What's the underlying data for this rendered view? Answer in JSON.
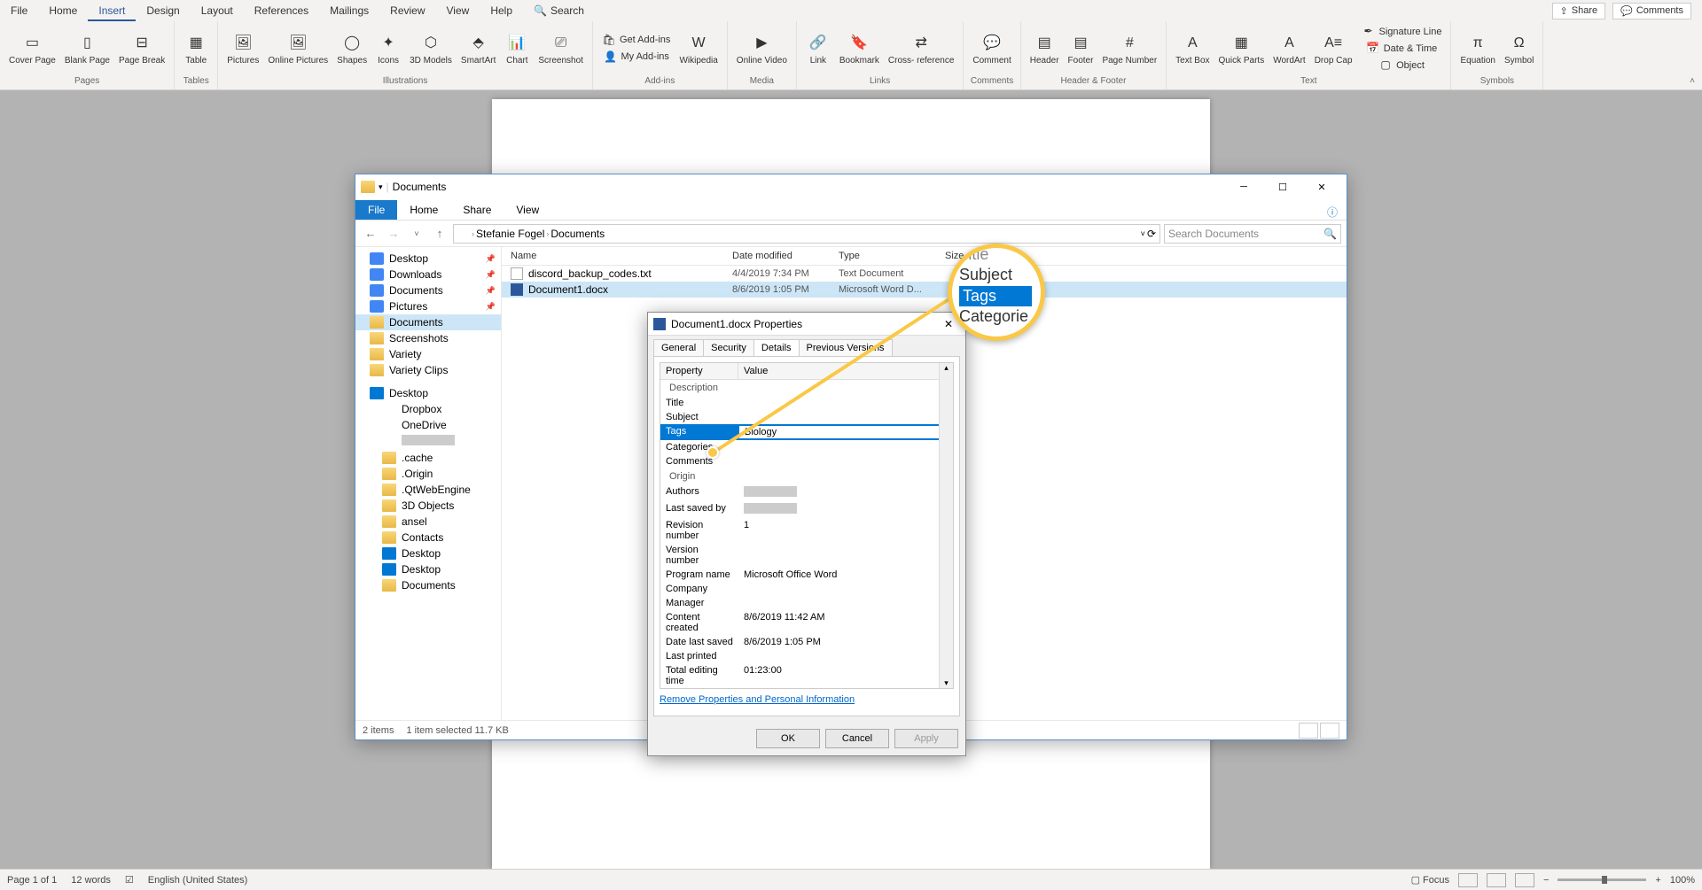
{
  "ribbon": {
    "tabs": [
      "File",
      "Home",
      "Insert",
      "Design",
      "Layout",
      "References",
      "Mailings",
      "Review",
      "View",
      "Help"
    ],
    "active_tab": "Insert",
    "search_label": "Search",
    "share_label": "Share",
    "comments_label": "Comments",
    "groups": {
      "pages": {
        "label": "Pages",
        "items": [
          "Cover\nPage",
          "Blank\nPage",
          "Page\nBreak"
        ]
      },
      "tables": {
        "label": "Tables",
        "items": [
          "Table"
        ]
      },
      "illustrations": {
        "label": "Illustrations",
        "items": [
          "Pictures",
          "Online\nPictures",
          "Shapes",
          "Icons",
          "3D\nModels",
          "SmartArt",
          "Chart",
          "Screenshot"
        ]
      },
      "addins": {
        "label": "Add-ins",
        "get": "Get Add-ins",
        "my": "My Add-ins",
        "wiki": "Wikipedia"
      },
      "media": {
        "label": "Media",
        "items": [
          "Online\nVideo"
        ]
      },
      "links": {
        "label": "Links",
        "items": [
          "Link",
          "Bookmark",
          "Cross-\nreference"
        ]
      },
      "comments": {
        "label": "Comments",
        "items": [
          "Comment"
        ]
      },
      "header_footer": {
        "label": "Header & Footer",
        "items": [
          "Header",
          "Footer",
          "Page\nNumber"
        ]
      },
      "text": {
        "label": "Text",
        "items": [
          "Text\nBox",
          "Quick\nParts",
          "WordArt",
          "Drop\nCap"
        ],
        "side": [
          "Signature Line",
          "Date & Time",
          "Object"
        ]
      },
      "symbols": {
        "label": "Symbols",
        "items": [
          "Equation",
          "Symbol"
        ]
      }
    }
  },
  "explorer": {
    "title": "Documents",
    "tabs": {
      "file": "File",
      "home": "Home",
      "share": "Share",
      "view": "View"
    },
    "breadcrumb": [
      "Stefanie Fogel",
      "Documents"
    ],
    "search_placeholder": "Search Documents",
    "columns": {
      "name": "Name",
      "date": "Date modified",
      "type": "Type",
      "size": "Size"
    },
    "files": [
      {
        "name": "discord_backup_codes.txt",
        "date": "4/4/2019 7:34 PM",
        "type": "Text Document",
        "selected": false,
        "kind": "txt"
      },
      {
        "name": "Document1.docx",
        "date": "8/6/2019 1:05 PM",
        "type": "Microsoft Word D...",
        "selected": true,
        "kind": "word"
      }
    ],
    "nav_quick": [
      {
        "label": "Desktop",
        "ico": "blue",
        "pin": true
      },
      {
        "label": "Downloads",
        "ico": "blue",
        "pin": true
      },
      {
        "label": "Documents",
        "ico": "blue",
        "pin": true
      },
      {
        "label": "Pictures",
        "ico": "blue",
        "pin": true
      },
      {
        "label": "Documents",
        "ico": "folder",
        "selected": true
      },
      {
        "label": "Screenshots",
        "ico": "folder"
      },
      {
        "label": "Variety",
        "ico": "folder"
      },
      {
        "label": "Variety Clips",
        "ico": "folder"
      }
    ],
    "nav_desktop": [
      {
        "label": "Desktop",
        "ico": "monitor"
      },
      {
        "label": "Dropbox",
        "ico": "cloud",
        "indent": true
      },
      {
        "label": "OneDrive",
        "ico": "cloud",
        "indent": true
      },
      {
        "label": "",
        "ico": "green",
        "indent": true
      },
      {
        "label": ".cache",
        "ico": "folder",
        "indent": true
      },
      {
        "label": ".Origin",
        "ico": "folder",
        "indent": true
      },
      {
        "label": ".QtWebEngine",
        "ico": "folder",
        "indent": true
      },
      {
        "label": "3D Objects",
        "ico": "folder",
        "indent": true
      },
      {
        "label": "ansel",
        "ico": "folder",
        "indent": true
      },
      {
        "label": "Contacts",
        "ico": "folder",
        "indent": true
      },
      {
        "label": "Desktop",
        "ico": "monitor",
        "indent": true
      },
      {
        "label": "Desktop",
        "ico": "monitor",
        "indent": true
      },
      {
        "label": "Documents",
        "ico": "folder",
        "indent": true
      }
    ],
    "status": {
      "items": "2 items",
      "selection": "1 item selected  11.7 KB"
    }
  },
  "props": {
    "title": "Document1.docx Properties",
    "tabs": [
      "General",
      "Security",
      "Details",
      "Previous Versions"
    ],
    "active_tab": "Details",
    "headers": {
      "property": "Property",
      "value": "Value"
    },
    "group_description": "Description",
    "group_origin": "Origin",
    "rows_desc": [
      {
        "label": "Title",
        "value": ""
      },
      {
        "label": "Subject",
        "value": ""
      },
      {
        "label": "Tags",
        "value": "Biology",
        "selected": true
      },
      {
        "label": "Categories",
        "value": ""
      },
      {
        "label": "Comments",
        "value": ""
      }
    ],
    "rows_origin": [
      {
        "label": "Authors",
        "value": "",
        "redacted": true
      },
      {
        "label": "Last saved by",
        "value": "",
        "redacted": true
      },
      {
        "label": "Revision number",
        "value": "1"
      },
      {
        "label": "Version number",
        "value": ""
      },
      {
        "label": "Program name",
        "value": "Microsoft Office Word"
      },
      {
        "label": "Company",
        "value": ""
      },
      {
        "label": "Manager",
        "value": ""
      },
      {
        "label": "Content created",
        "value": "8/6/2019 11:42 AM"
      },
      {
        "label": "Date last saved",
        "value": "8/6/2019 1:05 PM"
      },
      {
        "label": "Last printed",
        "value": ""
      },
      {
        "label": "Total editing time",
        "value": "01:23:00"
      }
    ],
    "remove_link": "Remove Properties and Personal Information",
    "buttons": {
      "ok": "OK",
      "cancel": "Cancel",
      "apply": "Apply"
    }
  },
  "callout": {
    "items": [
      "Title",
      "Subject",
      "Tags",
      "Categorie"
    ]
  },
  "statusbar": {
    "page": "Page 1 of 1",
    "words": "12 words",
    "lang": "English (United States)",
    "focus": "Focus",
    "zoom": "100%"
  }
}
